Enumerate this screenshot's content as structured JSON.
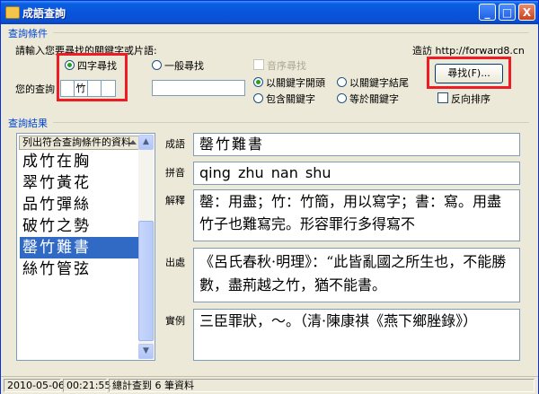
{
  "window": {
    "title": "成語查詢",
    "controls": {
      "minimize": "_",
      "maximize": "□",
      "close": "X"
    }
  },
  "query": {
    "group_title": "查詢條件",
    "prompt": "請輸入您要尋找的關鍵字或片語:",
    "visit_link": "造訪 http://forward8.cn",
    "mode_four_char": "四字尋找",
    "mode_general": "一般尋找",
    "sequence_search": "音序尋找",
    "your_query_label": "您的查詢",
    "query_chars": [
      "",
      "竹",
      "",
      ""
    ],
    "general_input_value": "",
    "opt_starts_with": "以關鍵字開頭",
    "opt_ends_with": "以關鍵字結尾",
    "opt_contains": "包含關鍵字",
    "opt_equals": "等於關鍵字",
    "find_button": "尋找(F)...",
    "reverse_sort": "反向排序"
  },
  "results": {
    "group_title": "查詢結果",
    "list_header": "列出符合查詢條件的資料",
    "items": [
      "成竹在胸",
      "翠竹黃花",
      "品竹彈絲",
      "破竹之勢",
      "罄竹難書",
      "絲竹管弦"
    ],
    "selected_index": 4,
    "idiom_label": "成語",
    "idiom_value": "罄竹難書",
    "pinyin_label": "拼音",
    "pinyin_value": "qing zhu nan shu",
    "explain_label": "解釋",
    "explain_value": "罄：用盡；竹：竹簡，用以寫字；書：寫。用盡竹子也難寫完。形容罪行多得寫不",
    "source_label": "出處",
    "source_value": "《呂氏春秋·明理》：“此皆亂國之所生也，不能勝數，盡荊越之竹，猶不能書。",
    "example_label": "實例",
    "example_value": "三臣罪狀，～。（清·陳康祺《燕下鄉脞錄》）"
  },
  "status": {
    "date": "2010-05-06",
    "time": "00:21:55",
    "message": "總計查到 6 筆資料"
  },
  "colors": {
    "title_bar": "#0855dd",
    "group_title": "#0046d5",
    "selection": "#316ac5",
    "highlight_box": "#ee1c24"
  }
}
